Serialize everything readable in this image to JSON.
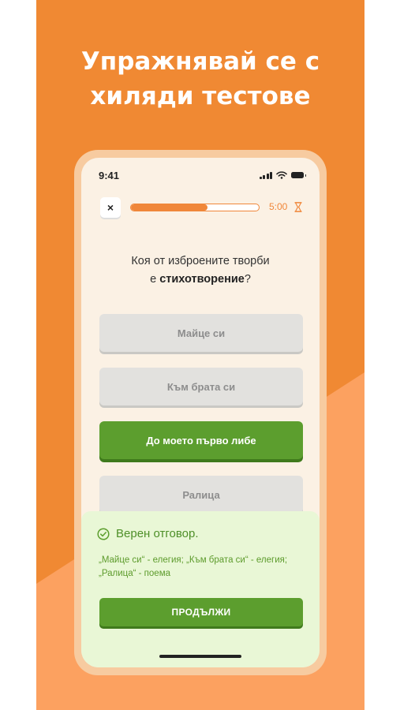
{
  "colors": {
    "background": "#F08933",
    "background_light": "#FCA160",
    "accent_orange": "#F0873A",
    "correct_green": "#5C9E2E",
    "feedback_bg": "#E9F7D6"
  },
  "headline": {
    "line1": "Упражнявай се с",
    "line2": "хиляди тестове"
  },
  "status_bar": {
    "time": "9:41",
    "icons": [
      "signal-icon",
      "wifi-icon",
      "battery-icon"
    ]
  },
  "quiz": {
    "close_label": "×",
    "progress": 0.6,
    "timer": "5:00",
    "timer_icon": "hourglass-icon",
    "question_part1": "Коя от изброените творби",
    "question_part2": "е ",
    "question_bold": "стихотворение",
    "question_end": "?",
    "options": [
      {
        "label": "Майце си",
        "state": "neutral"
      },
      {
        "label": "Към брата си",
        "state": "neutral"
      },
      {
        "label": "До моето първо либе",
        "state": "correct"
      },
      {
        "label": "Ралица",
        "state": "neutral"
      }
    ]
  },
  "feedback": {
    "icon": "check-circle-icon",
    "title": "Верен отговор.",
    "text": "„Майце си“ - елегия; „Към брата си“ - елегия; „Ралица“ - поема",
    "continue_label": "ПРОДЪЛЖИ"
  }
}
